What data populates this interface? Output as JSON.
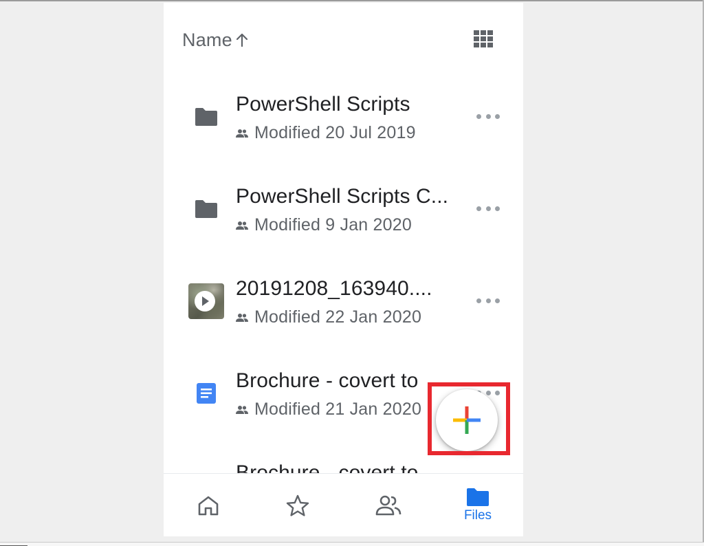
{
  "header": {
    "sort_label": "Name",
    "sort_direction_icon": "arrow-up-icon",
    "view_toggle_icon": "grid-view-icon"
  },
  "files": [
    {
      "name": "PowerShell Scripts",
      "modified": "Modified 20 Jul 2019",
      "type_icon": "folder-icon",
      "shared_icon": "people-icon"
    },
    {
      "name": "PowerShell Scripts C...",
      "modified": "Modified 9 Jan 2020",
      "type_icon": "folder-icon",
      "shared_icon": "people-icon"
    },
    {
      "name": "20191208_163940....",
      "modified": "Modified 22 Jan 2020",
      "type_icon": "video-thumbnail-icon",
      "shared_icon": "people-icon"
    },
    {
      "name": "Brochure - covert to",
      "modified": "Modified 21 Jan 2020",
      "type_icon": "google-docs-icon",
      "shared_icon": "people-icon"
    },
    {
      "name": "Brochure - covert to",
      "modified": "",
      "type_icon": "",
      "shared_icon": ""
    }
  ],
  "fab": {
    "icon": "plus-icon"
  },
  "bottom_nav": {
    "items": [
      {
        "icon": "home-icon",
        "label": ""
      },
      {
        "icon": "star-icon",
        "label": ""
      },
      {
        "icon": "shared-people-icon",
        "label": ""
      },
      {
        "icon": "folder-icon",
        "label": "Files",
        "active": true
      }
    ]
  },
  "colors": {
    "accent_blue": "#1a73e8",
    "highlight_red": "#e8282f",
    "icon_grey": "#5f6368",
    "text_dark": "#202124",
    "google_red": "#ea4335",
    "google_yellow": "#fbbc04",
    "google_green": "#34a853",
    "google_blue": "#4285f4"
  }
}
